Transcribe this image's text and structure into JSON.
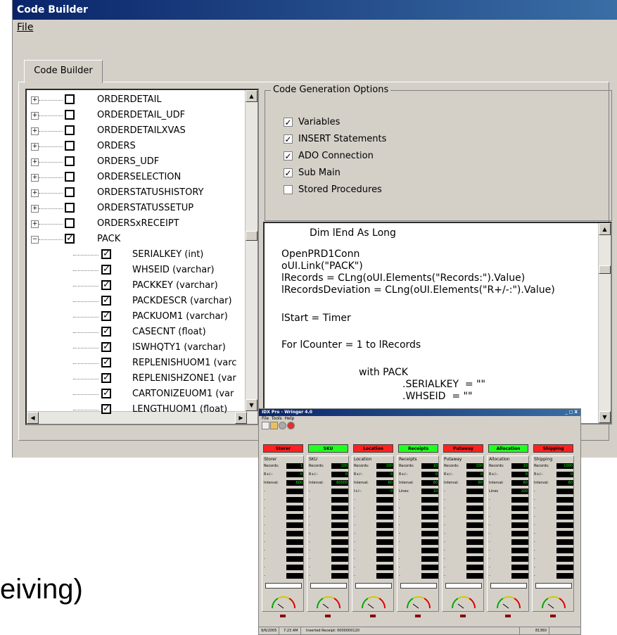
{
  "main_window": {
    "title": "Code Builder",
    "menu": {
      "file": "File"
    },
    "tab": "Code Builder"
  },
  "tree": {
    "tables": [
      {
        "label": "ORDERDETAIL",
        "checked": false
      },
      {
        "label": "ORDERDETAIL_UDF",
        "checked": false
      },
      {
        "label": "ORDERDETAILXVAS",
        "checked": false
      },
      {
        "label": "ORDERS",
        "checked": false
      },
      {
        "label": "ORDERS_UDF",
        "checked": false
      },
      {
        "label": "ORDERSELECTION",
        "checked": false
      },
      {
        "label": "ORDERSTATUSHISTORY",
        "checked": false
      },
      {
        "label": "ORDERSTATUSSETUP",
        "checked": false
      },
      {
        "label": "ORDERSxRECEIPT",
        "checked": false
      },
      {
        "label": "PACK",
        "checked": true
      }
    ],
    "columns": [
      "SERIALKEY (int)",
      "WHSEID (varchar)",
      "PACKKEY (varchar)",
      "PACKDESCR (varchar)",
      "PACKUOM1 (varchar)",
      "CASECNT (float)",
      "ISWHQTY1 (varchar)",
      "REPLENISHUOM1 (varc",
      "REPLENISHZONE1 (var",
      "CARTONIZEUOM1 (var",
      "LENGTHUOM1 (float)"
    ]
  },
  "options": {
    "legend": "Code Generation Options",
    "items": [
      {
        "label": "Variables",
        "checked": true
      },
      {
        "label": "INSERT Statements",
        "checked": true
      },
      {
        "label": "ADO Connection",
        "checked": true
      },
      {
        "label": "Sub Main",
        "checked": true
      },
      {
        "label": "Stored Procedures",
        "checked": false
      }
    ]
  },
  "code": {
    "lines": [
      "Dim lEnd As Long",
      "OpenPRD1Conn",
      "oUI.Link(\"PACK\")",
      "lRecords = CLng(oUI.Elements(\"Records:\").Value)",
      "lRecordsDeviation = CLng(oUI.Elements(\"R+/-:\").Value)",
      "lStart = Timer",
      "For lCounter = 1 to lRecords",
      "with PACK",
      ".SERIALKEY  = \"\"",
      ".WHSEID  = \"\""
    ]
  },
  "background_text": "eiving)",
  "wringer": {
    "title": "IDX Pro - Wringer 4.0",
    "menu": [
      "File",
      "Tools",
      "Help"
    ],
    "controls": "_ □ X",
    "buttons": [
      {
        "label": "Storer",
        "color": "#ff2020"
      },
      {
        "label": "SKU",
        "color": "#20ff20"
      },
      {
        "label": "Location",
        "color": "#ff2020"
      },
      {
        "label": "Receipts",
        "color": "#20ff20"
      },
      {
        "label": "Putaway",
        "color": "#ff2020"
      },
      {
        "label": "Allocation",
        "color": "#20ff20"
      },
      {
        "label": "Shipping",
        "color": "#ff2020"
      }
    ],
    "columns": [
      {
        "header": "Storer",
        "fields": [
          {
            "label": "Records:",
            "value": "1"
          },
          {
            "label": "R+/-:",
            "value": "0"
          },
          {
            "label": "Interval:",
            "value": "600"
          }
        ]
      },
      {
        "header": "SKU",
        "fields": [
          {
            "label": "Records:",
            "value": "100"
          },
          {
            "label": "R+/-:",
            "value": "0"
          },
          {
            "label": "Interval:",
            "value": "60000"
          }
        ]
      },
      {
        "header": "Location",
        "fields": [
          {
            "label": "Records:",
            "value": "100"
          },
          {
            "label": "R+/-:",
            "value": "0"
          },
          {
            "label": "Interval:",
            "value": "60"
          },
          {
            "label": "I+/-:",
            "value": "0"
          }
        ]
      },
      {
        "header": "Receipts",
        "fields": [
          {
            "label": "Records:",
            "value": "10"
          },
          {
            "label": "R+/-:",
            "value": "0"
          },
          {
            "label": "Interval:",
            "value": "60"
          },
          {
            "label": "Lines:",
            "value": "10"
          }
        ]
      },
      {
        "header": "Putaway",
        "fields": [
          {
            "label": "Records:",
            "value": "100"
          },
          {
            "label": "R+/-:",
            "value": "0"
          },
          {
            "label": "Interval:",
            "value": "60"
          }
        ]
      },
      {
        "header": "Allocation",
        "fields": [
          {
            "label": "Records:",
            "value": "10"
          },
          {
            "label": "R+/-:",
            "value": "0"
          },
          {
            "label": "Interval:",
            "value": "60"
          },
          {
            "label": "Lines",
            "value": "100"
          }
        ]
      },
      {
        "header": "Shipping",
        "fields": [
          {
            "label": "Records:",
            "value": "1000"
          },
          {
            "label": "R+/-:",
            "value": "0"
          },
          {
            "label": "Interval:",
            "value": "60"
          }
        ]
      }
    ],
    "gauge_ticks": [
      "40",
      "50",
      "60",
      "30",
      "70",
      "20",
      "80",
      "10",
      "90",
      "0",
      "100"
    ],
    "status": {
      "date": "9/6/2005",
      "time": "7:23 AM",
      "message": "Inserted Receipt: 0000000120",
      "count": "81360"
    }
  }
}
